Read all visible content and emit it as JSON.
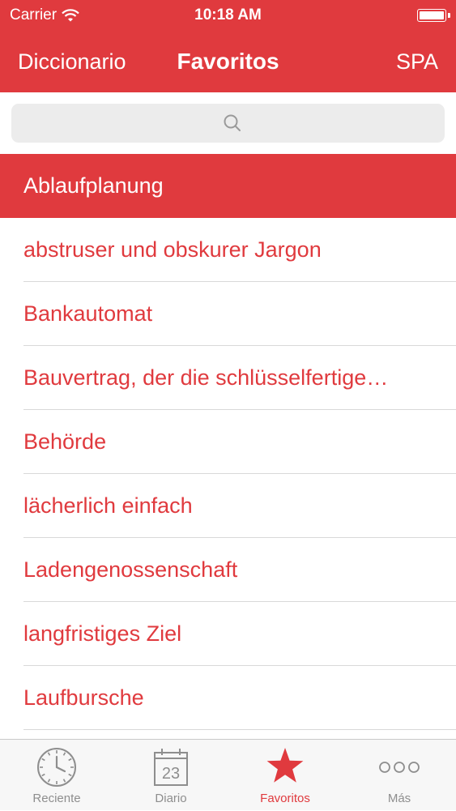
{
  "status_bar": {
    "carrier": "Carrier",
    "time": "10:18 AM"
  },
  "nav": {
    "back_label": "Diccionario",
    "title": "Favoritos",
    "language": "SPA"
  },
  "search": {
    "placeholder": ""
  },
  "favorites": [
    {
      "label": "Ablaufplanung",
      "selected": true
    },
    {
      "label": "abstruser und obskurer Jargon"
    },
    {
      "label": "Bankautomat"
    },
    {
      "label": "Bauvertrag, der die schlüsselfertige…"
    },
    {
      "label": "Behörde"
    },
    {
      "label": "lächerlich einfach"
    },
    {
      "label": "Ladengenossenschaft"
    },
    {
      "label": "langfristiges Ziel"
    },
    {
      "label": "Laufbursche"
    }
  ],
  "tabbar": {
    "tabs": [
      {
        "label": "Reciente",
        "icon": "clock-icon"
      },
      {
        "label": "Diario",
        "icon": "calendar-icon",
        "calendar_day": "23"
      },
      {
        "label": "Favoritos",
        "icon": "star-icon",
        "active": true
      },
      {
        "label": "Más",
        "icon": "more-icon"
      }
    ]
  },
  "colors": {
    "accent": "#e03a3e",
    "tab_inactive": "#8e8e8e",
    "separator": "#d9d9d9"
  }
}
